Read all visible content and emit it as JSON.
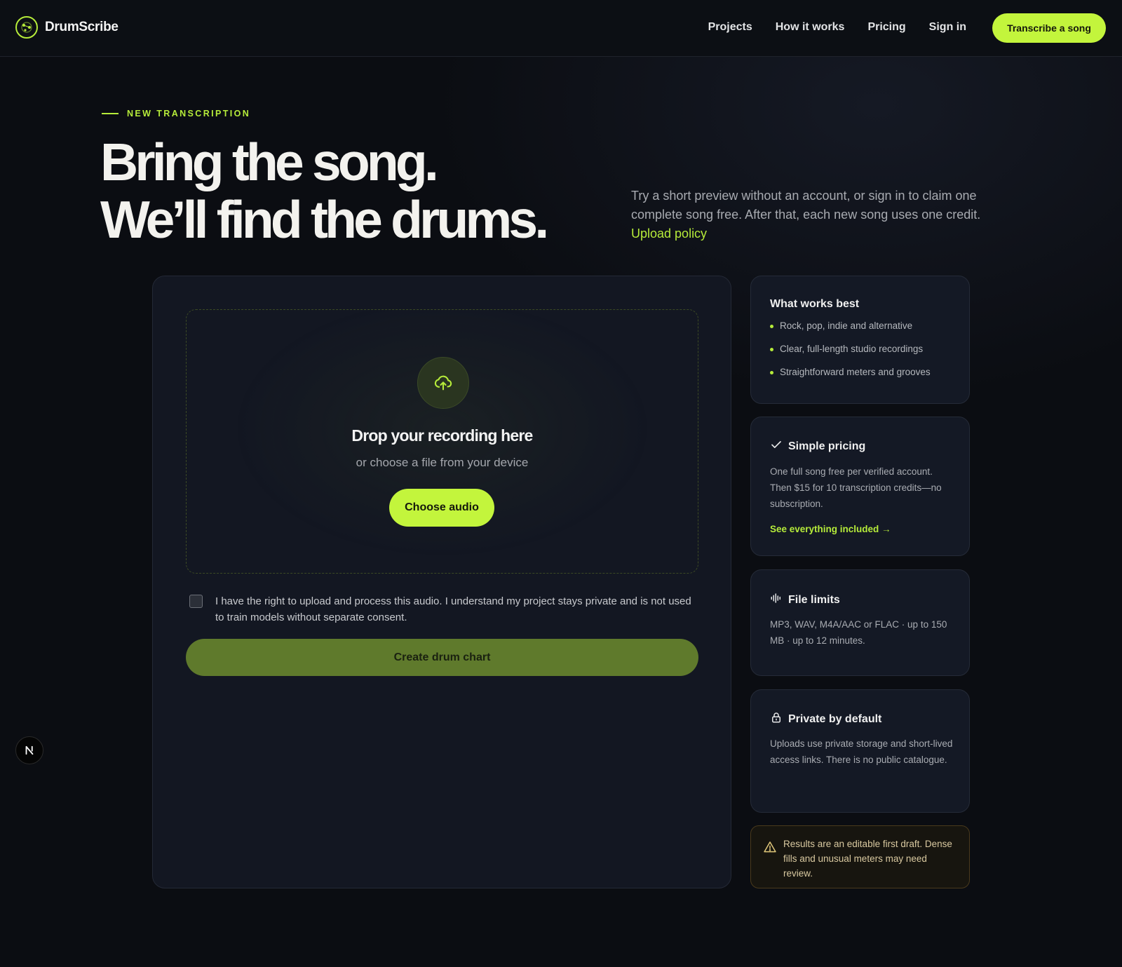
{
  "brand": {
    "name": "DrumScribe",
    "logo_icon": "drum-logo-icon"
  },
  "nav": {
    "links": [
      "Projects",
      "How it works",
      "Pricing",
      "Sign in"
    ],
    "cta": "Transcribe a song"
  },
  "hero": {
    "eyebrow": "NEW TRANSCRIPTION",
    "headline_line1": "Bring the song.",
    "headline_line2": "We’ll find the drums.",
    "copy": "Try a short preview without an account, or sign in to claim one complete song free. After that, each new song uses one credit.",
    "link": "Upload policy"
  },
  "upload": {
    "icon": "cloud-upload-icon",
    "title": "Drop your recording here",
    "subtitle": "or choose a file from your device",
    "choose_button": "Choose audio",
    "consent": "I have the right to upload and process this audio. I understand my project stays private and is not used to train models without separate consent.",
    "consent_checked": false,
    "create_button": "Create drum chart"
  },
  "side": {
    "works_best": {
      "title": "What works best",
      "items": [
        "Rock, pop, indie and alternative",
        "Clear, full-length studio recordings",
        "Straightforward meters and grooves"
      ]
    },
    "pricing": {
      "title": "Simple pricing",
      "icon": "check-icon",
      "body": "One full song free per verified account. Then $15 for 10 transcription credits—no subscription.",
      "link": "See everything included →"
    },
    "limits": {
      "title": "File limits",
      "icon": "waveform-icon",
      "body": "MP3, WAV, M4A/AAC or FLAC · up to 150 MB · up to 12 minutes."
    },
    "privacy": {
      "title": "Private by default",
      "icon": "lock-icon",
      "body": "Uploads use private storage and short-lived access links. There is no public catalogue."
    },
    "warning": {
      "icon": "warning-icon",
      "text": "Results are an editable first draft. Dense fills and unusual meters may need review."
    }
  },
  "dev_badge": {
    "label": "N",
    "icon": "nextjs-icon"
  },
  "colors": {
    "accent": "#c3f53c",
    "background": "#0b0d12",
    "card": "#131722",
    "create_button": "#5f7a2c"
  }
}
